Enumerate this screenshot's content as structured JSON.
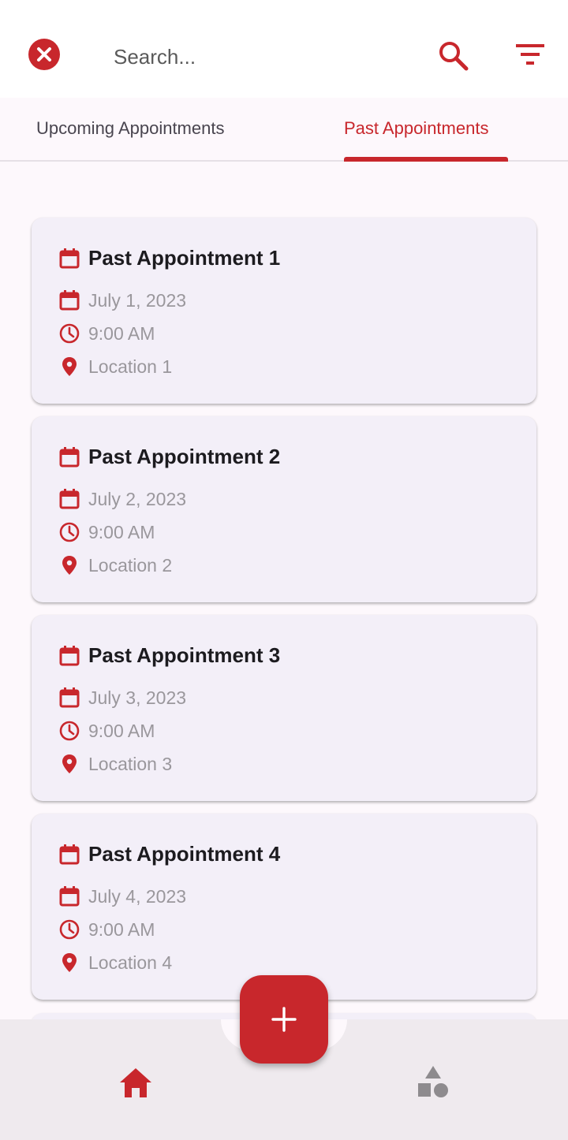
{
  "search": {
    "placeholder": "Search..."
  },
  "tabs": [
    {
      "label": "Upcoming Appointments",
      "selected": false
    },
    {
      "label": "Past Appointments",
      "selected": true
    }
  ],
  "appointments": [
    {
      "title": "Past Appointment 1",
      "date": "July 1, 2023",
      "time": "9:00 AM",
      "location": "Location 1"
    },
    {
      "title": "Past Appointment 2",
      "date": "July 2, 2023",
      "time": "9:00 AM",
      "location": "Location 2"
    },
    {
      "title": "Past Appointment 3",
      "date": "July 3, 2023",
      "time": "9:00 AM",
      "location": "Location 3"
    },
    {
      "title": "Past Appointment 4",
      "date": "July 4, 2023",
      "time": "9:00 AM",
      "location": "Location 4"
    }
  ],
  "icons": {
    "close": "close-circle-icon",
    "search": "search-icon",
    "filter": "filter-icon",
    "calendar": "calendar-icon",
    "clock": "clock-icon",
    "location": "location-pin-icon",
    "add": "plus-icon",
    "home": "home-icon",
    "shapes": "shapes-icon"
  },
  "colors": {
    "accent": "#c8272c",
    "card_bg": "#f3eff8",
    "muted_text": "#9a979c",
    "nav_inactive": "#8e8b8e"
  }
}
